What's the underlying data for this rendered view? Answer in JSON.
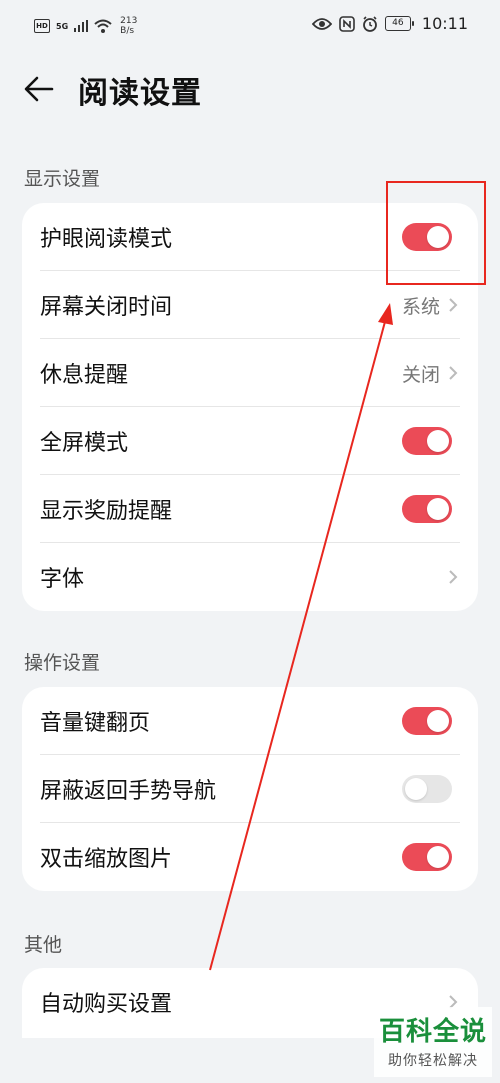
{
  "status_bar": {
    "hd": "HD",
    "signal": "5G",
    "net_speed_value": "213",
    "net_speed_unit": "B/s",
    "battery": "46",
    "time": "10:11"
  },
  "header": {
    "title": "阅读设置"
  },
  "sections": {
    "display": {
      "label": "显示设置",
      "items": [
        {
          "label": "护眼阅读模式",
          "toggle": true
        },
        {
          "label": "屏幕关闭时间",
          "value": "系统"
        },
        {
          "label": "休息提醒",
          "value": "关闭"
        },
        {
          "label": "全屏模式",
          "toggle": true
        },
        {
          "label": "显示奖励提醒",
          "toggle": true
        },
        {
          "label": "字体"
        }
      ]
    },
    "operation": {
      "label": "操作设置",
      "items": [
        {
          "label": "音量键翻页",
          "toggle": true
        },
        {
          "label": "屏蔽返回手势导航",
          "toggle": false
        },
        {
          "label": "双击缩放图片",
          "toggle": true
        }
      ]
    },
    "other": {
      "label": "其他",
      "items": [
        {
          "label": "自动购买设置"
        }
      ]
    }
  },
  "colors": {
    "toggle_on": "#eb4b57",
    "toggle_off": "#e6e6e6",
    "annotation": "#e8271f",
    "watermark": "#1a8f3b"
  },
  "watermark": {
    "title": "百科全说",
    "subtitle": "助你轻松解决"
  }
}
